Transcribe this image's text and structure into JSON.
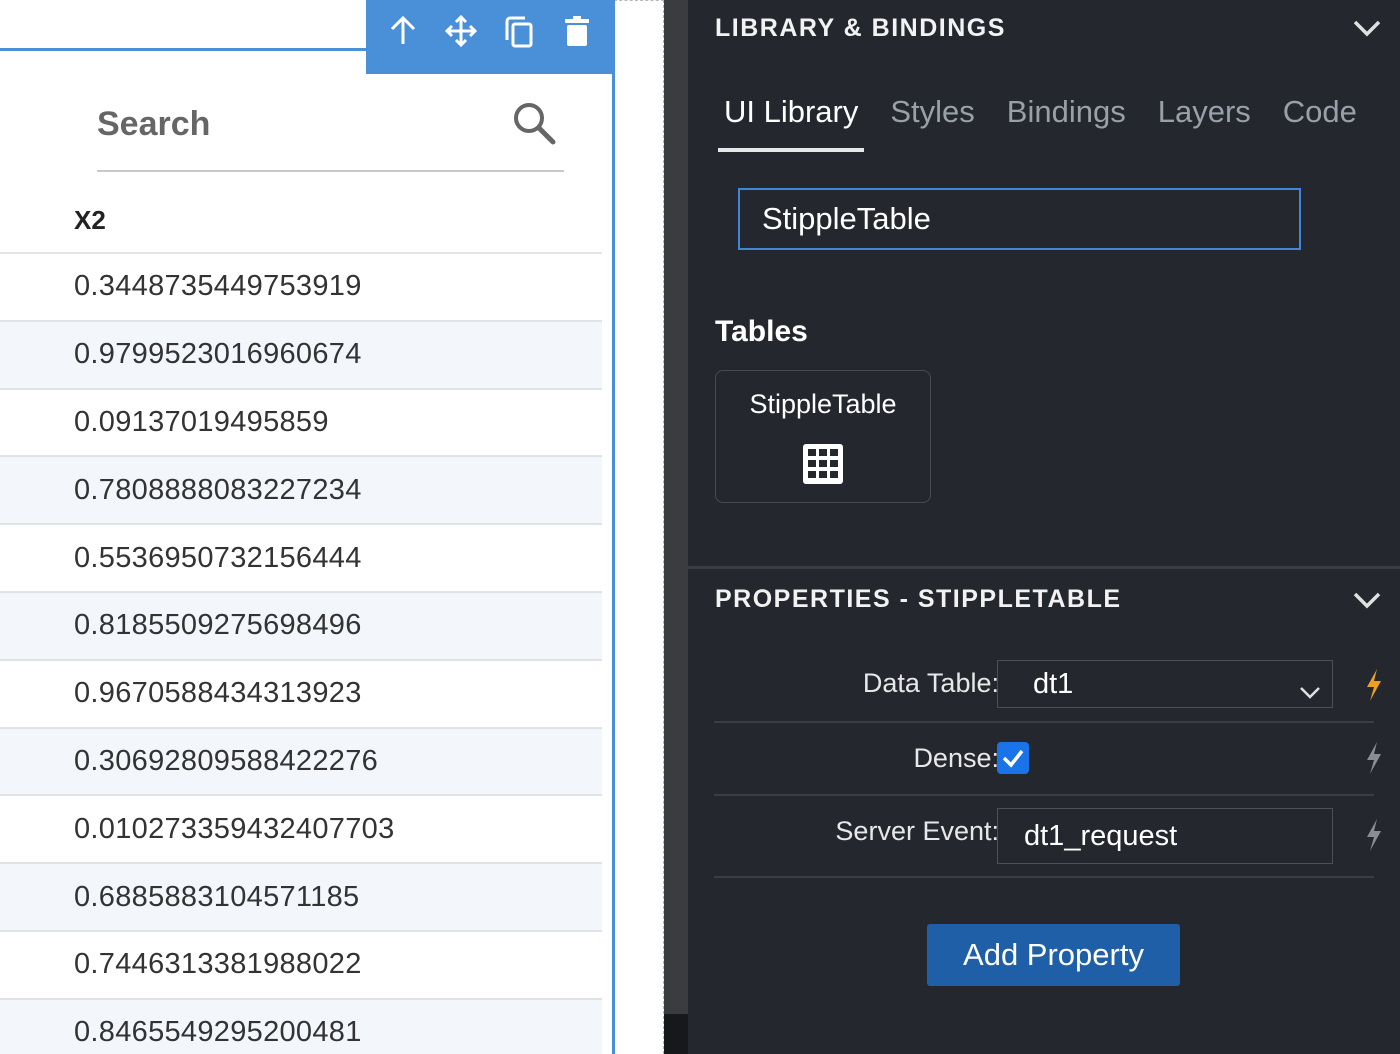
{
  "canvas": {
    "search": {
      "placeholder": "Search"
    },
    "table": {
      "column_header": "X2",
      "rows": [
        "0.3448735449753919",
        "0.9799523016960674",
        "0.09137019495859",
        "0.7808888083227234",
        "0.5536950732156444",
        "0.8185509275698496",
        "0.9670588434313923",
        "0.30692809588422276",
        "0.010273359432407703",
        "0.6885883104571185",
        "0.7446313381988022",
        "0.8465549295200481"
      ]
    },
    "toolbar": {
      "icons": [
        "arrow-up-icon",
        "move-icon",
        "copy-icon",
        "trash-icon"
      ]
    }
  },
  "panel": {
    "library": {
      "title": "LIBRARY & BINDINGS",
      "tabs": [
        {
          "label": "UI Library",
          "active": true
        },
        {
          "label": "Styles",
          "active": false
        },
        {
          "label": "Bindings",
          "active": false
        },
        {
          "label": "Layers",
          "active": false
        },
        {
          "label": "Code",
          "active": false
        }
      ],
      "search_value": "StippleTable",
      "section_title": "Tables",
      "component_card": {
        "label": "StippleTable",
        "icon": "grid-table-icon"
      }
    },
    "properties": {
      "title": "PROPERTIES - STIPPLETABLE",
      "data_table": {
        "label": "Data Table:",
        "value": "dt1"
      },
      "dense": {
        "label": "Dense:",
        "checked": true
      },
      "server_event": {
        "label": "Server Event:",
        "value": "dt1_request"
      },
      "add_button": "Add Property"
    }
  },
  "colors": {
    "selection_blue": "#4a90d9",
    "panel_bg": "#24272e",
    "active_bolt": "#f0a020",
    "inactive_bolt": "#8a8d93",
    "button_blue": "#1f5fa8",
    "checkbox_blue": "#1a73e8"
  }
}
